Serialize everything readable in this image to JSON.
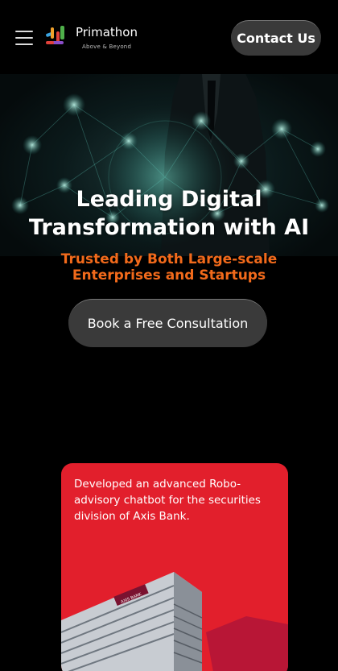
{
  "header": {
    "brand_name": "Primathon",
    "brand_tagline": "Above & Beyond",
    "contact_label": "Contact Us"
  },
  "hero": {
    "title_line1": "Leading Digital",
    "title_line2": "Transformation with AI",
    "subtitle_line1": "Trusted by Both Large-scale",
    "subtitle_line2": "Enterprises and Startups",
    "cta_label": "Book a Free Consultation"
  },
  "case_study": {
    "text": "Developed an advanced Robo-advisory chatbot for the securities division of Axis Bank.",
    "sign_text": "AXIS BANK"
  },
  "colors": {
    "background": "#000000",
    "accent_orange": "#f26a1b",
    "card_red": "#e21f2c",
    "button_gray": "#3a3a3a"
  }
}
